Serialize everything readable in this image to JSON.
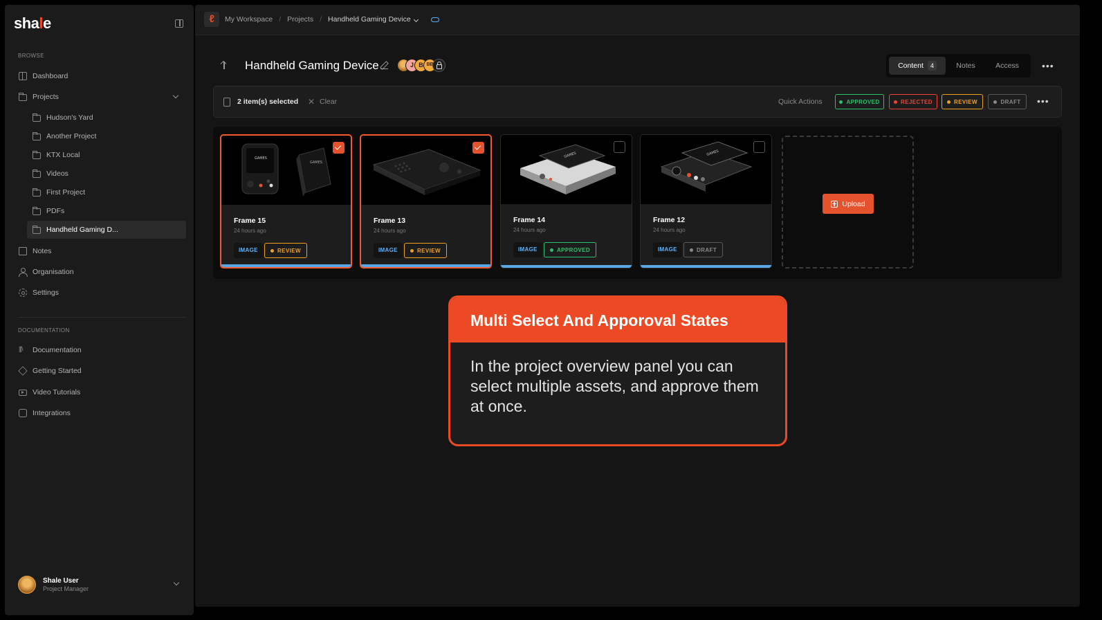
{
  "sidebar": {
    "logo": {
      "left": "sha",
      "accent": "l",
      "right": "e"
    },
    "browse_label": "BROWSE",
    "items": [
      {
        "label": "Dashboard",
        "icon": "grid-icon"
      },
      {
        "label": "Projects",
        "icon": "folder-icon"
      }
    ],
    "projects": [
      {
        "label": "Hudson's Yard"
      },
      {
        "label": "Another Project"
      },
      {
        "label": "KTX Local"
      },
      {
        "label": "Videos"
      },
      {
        "label": "First Project"
      },
      {
        "label": "PDFs"
      },
      {
        "label": "Handheld Gaming D..."
      }
    ],
    "items2": [
      {
        "label": "Notes",
        "icon": "book-icon"
      },
      {
        "label": "Organisation",
        "icon": "user-icon"
      },
      {
        "label": "Settings",
        "icon": "gear-icon"
      }
    ],
    "documentation_label": "DOCUMENTATION",
    "docs": [
      {
        "label": "Documentation",
        "icon": "library-icon"
      },
      {
        "label": "Getting Started",
        "icon": "diamond-icon"
      },
      {
        "label": "Video Tutorials",
        "icon": "video-icon"
      },
      {
        "label": "Integrations",
        "icon": "plug-icon"
      }
    ],
    "user": {
      "name": "Shale User",
      "role": "Project Manager"
    }
  },
  "topbar": {
    "workspace_logo": "ℓ",
    "breadcrumbs": [
      "My Workspace",
      "Projects",
      "Handheld Gaming Device"
    ]
  },
  "header": {
    "title": "Handheld Gaming Device",
    "avatars": [
      "J",
      "B",
      "BB"
    ],
    "tabs": [
      {
        "label": "Content",
        "count": "4"
      },
      {
        "label": "Notes"
      },
      {
        "label": "Access"
      }
    ],
    "more": "•••"
  },
  "selection_bar": {
    "selected_text": "2 item(s) selected",
    "clear_label": "Clear",
    "quick_actions_label": "Quick Actions",
    "actions": [
      {
        "label": "APPROVED",
        "color": "#27c46b"
      },
      {
        "label": "REJECTED",
        "color": "#f04438"
      },
      {
        "label": "REVIEW",
        "color": "#f0a020"
      },
      {
        "label": "DRAFT",
        "color": "#8a8a8a"
      }
    ],
    "more": "•••"
  },
  "cards": [
    {
      "title": "Frame 15",
      "time": "24 hours ago",
      "type": "IMAGE",
      "status": "REVIEW",
      "status_color": "#f0a020",
      "selected": true
    },
    {
      "title": "Frame 13",
      "time": "24 hours ago",
      "type": "IMAGE",
      "status": "REVIEW",
      "status_color": "#f0a020",
      "selected": true
    },
    {
      "title": "Frame 14",
      "time": "24 hours ago",
      "type": "IMAGE",
      "status": "APPROVED",
      "status_color": "#27c46b",
      "selected": false
    },
    {
      "title": "Frame 12",
      "time": "24 hours ago",
      "type": "IMAGE",
      "status": "DRAFT",
      "status_color": "#8a8a8a",
      "selected": false
    }
  ],
  "upload": {
    "label": "Upload"
  },
  "callout": {
    "title": "Multi Select And Apporoval States",
    "body": "In the project overview panel you can select multiple assets, and approve them at once."
  }
}
